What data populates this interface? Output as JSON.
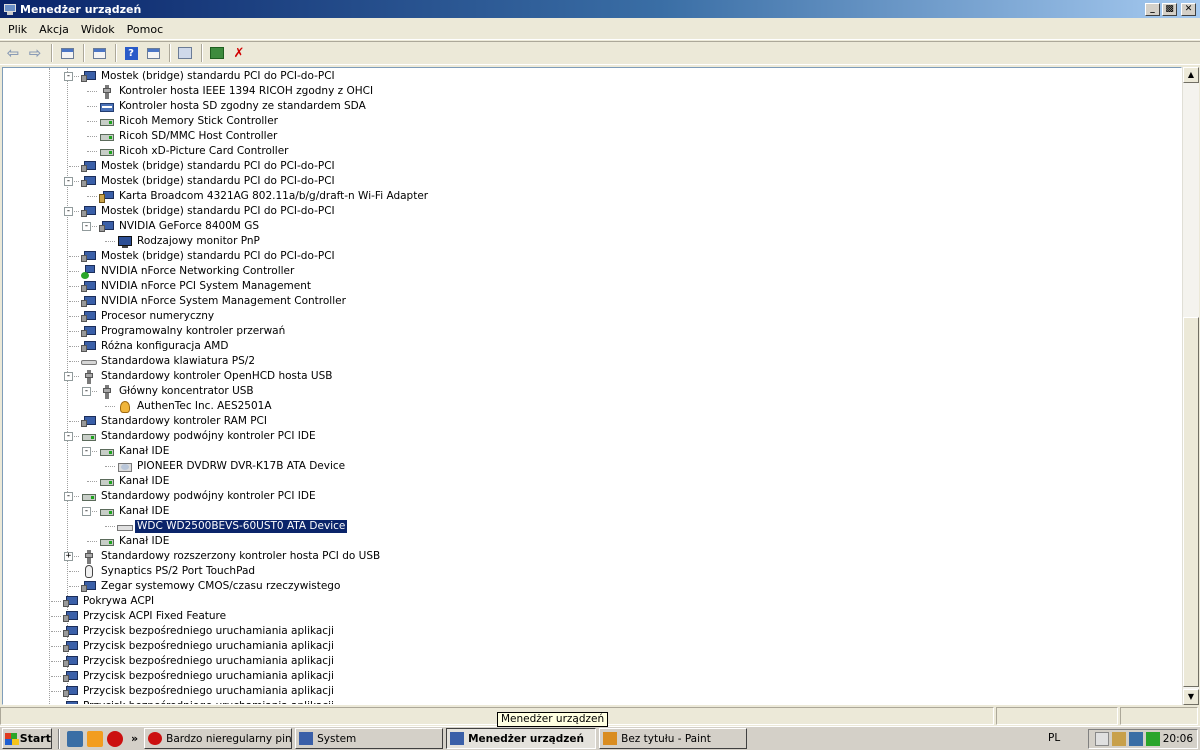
{
  "window": {
    "title": "Menedżer urządzeń"
  },
  "menu": [
    "Plik",
    "Akcja",
    "Widok",
    "Pomoc"
  ],
  "toolbar": [
    {
      "name": "back-button",
      "icon": "arrow-left-icon"
    },
    {
      "name": "forward-button",
      "icon": "arrow-right-icon"
    },
    {
      "name": "sep"
    },
    {
      "name": "show-hide-tree-button",
      "icon": "window-icon"
    },
    {
      "name": "sep"
    },
    {
      "name": "properties-button",
      "icon": "properties-icon"
    },
    {
      "name": "sep"
    },
    {
      "name": "help-button",
      "icon": "help-icon"
    },
    {
      "name": "view-button",
      "icon": "window-icon"
    },
    {
      "name": "sep"
    },
    {
      "name": "scan-hardware-button",
      "icon": "scan-icon"
    },
    {
      "name": "sep"
    },
    {
      "name": "update-driver-button",
      "icon": "update-icon"
    },
    {
      "name": "uninstall-button",
      "icon": "uninstall-icon"
    }
  ],
  "tree": [
    {
      "l": 2,
      "t": "Mostek (bridge) standardu PCI do PCI-do-PCI",
      "ic": "pci",
      "exp": "-"
    },
    {
      "l": 3,
      "t": "Kontroler hosta IEEE 1394 RICOH zgodny z OHCI",
      "ic": "usb"
    },
    {
      "l": 3,
      "t": "Kontroler hosta SD zgodny ze standardem SDA",
      "ic": "sd"
    },
    {
      "l": 3,
      "t": "Ricoh Memory Stick Controller",
      "ic": "ide"
    },
    {
      "l": 3,
      "t": "Ricoh SD/MMC Host Controller",
      "ic": "ide"
    },
    {
      "l": 3,
      "t": "Ricoh xD-Picture Card Controller",
      "ic": "ide"
    },
    {
      "l": 2,
      "t": "Mostek (bridge) standardu PCI do PCI-do-PCI",
      "ic": "pci"
    },
    {
      "l": 2,
      "t": "Mostek (bridge) standardu PCI do PCI-do-PCI",
      "ic": "pci",
      "exp": "-"
    },
    {
      "l": 3,
      "t": "Karta Broadcom 4321AG 802.11a/b/g/draft-n Wi-Fi Adapter",
      "ic": "wifi"
    },
    {
      "l": 2,
      "t": "Mostek (bridge) standardu PCI do PCI-do-PCI",
      "ic": "pci",
      "exp": "-"
    },
    {
      "l": 3,
      "t": "NVIDIA GeForce 8400M GS",
      "ic": "pci",
      "exp": "-"
    },
    {
      "l": 4,
      "t": "Rodzajowy monitor PnP",
      "ic": "mon"
    },
    {
      "l": 2,
      "t": "Mostek (bridge) standardu PCI do PCI-do-PCI",
      "ic": "pci"
    },
    {
      "l": 2,
      "t": "NVIDIA nForce Networking Controller",
      "ic": "net"
    },
    {
      "l": 2,
      "t": "NVIDIA nForce PCI System Management",
      "ic": "pci"
    },
    {
      "l": 2,
      "t": "NVIDIA nForce System Management Controller",
      "ic": "pci"
    },
    {
      "l": 2,
      "t": "Procesor numeryczny",
      "ic": "pci"
    },
    {
      "l": 2,
      "t": "Programowalny kontroler przerwań",
      "ic": "pci"
    },
    {
      "l": 2,
      "t": "Różna konfiguracja AMD",
      "ic": "pci"
    },
    {
      "l": 2,
      "t": "Standardowa klawiatura PS/2",
      "ic": "kbd"
    },
    {
      "l": 2,
      "t": "Standardowy kontroler OpenHCD hosta USB",
      "ic": "usb",
      "exp": "-"
    },
    {
      "l": 3,
      "t": "Główny koncentrator USB",
      "ic": "usb",
      "exp": "-"
    },
    {
      "l": 4,
      "t": "AuthenTec Inc. AES2501A",
      "ic": "bio"
    },
    {
      "l": 2,
      "t": "Standardowy kontroler RAM PCI",
      "ic": "pci"
    },
    {
      "l": 2,
      "t": "Standardowy podwójny kontroler PCI IDE",
      "ic": "ide",
      "exp": "-"
    },
    {
      "l": 3,
      "t": "Kanał IDE",
      "ic": "ide",
      "exp": "-"
    },
    {
      "l": 4,
      "t": "PIONEER DVDRW  DVR-K17B ATA Device",
      "ic": "cd"
    },
    {
      "l": 3,
      "t": "Kanał IDE",
      "ic": "ide"
    },
    {
      "l": 2,
      "t": "Standardowy podwójny kontroler PCI IDE",
      "ic": "ide",
      "exp": "-"
    },
    {
      "l": 3,
      "t": "Kanał IDE",
      "ic": "ide",
      "exp": "-"
    },
    {
      "l": 4,
      "t": "WDC WD2500BEVS-60UST0 ATA Device",
      "ic": "disk",
      "sel": true
    },
    {
      "l": 3,
      "t": "Kanał IDE",
      "ic": "ide"
    },
    {
      "l": 2,
      "t": "Standardowy rozszerzony kontroler hosta PCI do USB",
      "ic": "usb",
      "exp": "+"
    },
    {
      "l": 2,
      "t": "Synaptics PS/2 Port TouchPad",
      "ic": "mouse"
    },
    {
      "l": 2,
      "t": "Zegar systemowy CMOS/czasu rzeczywistego",
      "ic": "pci"
    },
    {
      "l": 1,
      "t": "Pokrywa ACPI",
      "ic": "pci"
    },
    {
      "l": 1,
      "t": "Przycisk ACPI Fixed Feature",
      "ic": "pci"
    },
    {
      "l": 1,
      "t": "Przycisk bezpośredniego uruchamiania aplikacji",
      "ic": "pci"
    },
    {
      "l": 1,
      "t": "Przycisk bezpośredniego uruchamiania aplikacji",
      "ic": "pci"
    },
    {
      "l": 1,
      "t": "Przycisk bezpośredniego uruchamiania aplikacji",
      "ic": "pci"
    },
    {
      "l": 1,
      "t": "Przycisk bezpośredniego uruchamiania aplikacji",
      "ic": "pci"
    },
    {
      "l": 1,
      "t": "Przycisk bezpośredniego uruchamiania aplikacji",
      "ic": "pci"
    },
    {
      "l": 1,
      "t": "Przycisk bezpośredniego uruchamiania aplikacji",
      "ic": "pci"
    }
  ],
  "tooltip": "Menedżer urządzeń",
  "taskbar": {
    "start": "Start",
    "chevron": "»",
    "tasks": [
      {
        "label": "Bardzo nieregularny ping...",
        "icon": "opera-icon",
        "color": "#cc1010"
      },
      {
        "label": "System",
        "icon": "system-icon",
        "color": "#3a5fa8"
      },
      {
        "label": "Menedżer urządzeń",
        "icon": "device-manager-icon",
        "color": "#3a5fa8",
        "active": true
      },
      {
        "label": "Bez tytułu - Paint",
        "icon": "paint-icon",
        "color": "#d98c1f"
      }
    ],
    "lang": "PL",
    "clock": "20:06"
  }
}
